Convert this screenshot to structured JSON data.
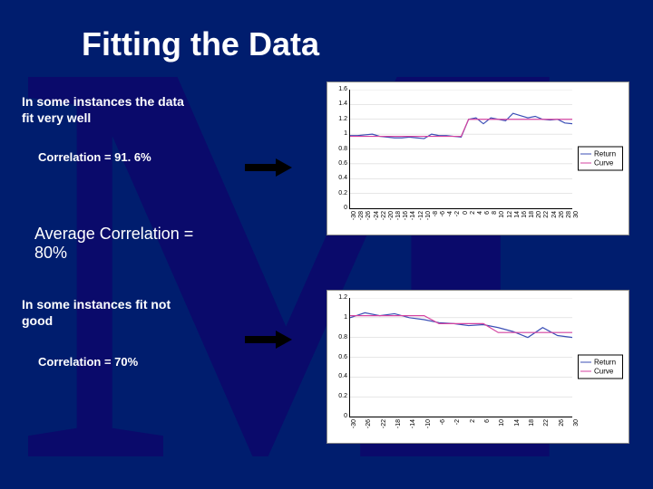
{
  "title": "Fitting the Data",
  "text": {
    "intro1": "In some instances the data\nfit very well",
    "corr1": "Correlation = 91. 6%",
    "avg": "Average Correlation =\n80%",
    "intro2": "In some instances fit not\ngood",
    "corr2": "Correlation = 70%"
  },
  "legend": {
    "return": "Return",
    "curve": "Curve",
    "return_color": "#3b4fb6",
    "curve_color": "#d443a0"
  },
  "chart_data": [
    {
      "type": "line",
      "title": "",
      "xlabel": "",
      "ylabel": "",
      "ylim": [
        0,
        1.6
      ],
      "yticks": [
        0,
        0.2,
        0.4,
        0.6,
        0.8,
        1,
        1.2,
        1.4,
        1.6
      ],
      "categories": [
        -30,
        -28,
        -26,
        -24,
        -22,
        -20,
        -18,
        -16,
        -14,
        -12,
        -10,
        -8,
        -6,
        -4,
        -2,
        0,
        2,
        4,
        6,
        8,
        10,
        12,
        14,
        16,
        18,
        20,
        22,
        24,
        26,
        28,
        30
      ],
      "series": [
        {
          "name": "Return",
          "color": "#3b4fb6",
          "values": [
            0.98,
            0.98,
            0.99,
            1.0,
            0.97,
            0.96,
            0.95,
            0.95,
            0.96,
            0.95,
            0.94,
            1.0,
            0.98,
            0.98,
            0.97,
            0.96,
            1.2,
            1.22,
            1.14,
            1.22,
            1.2,
            1.18,
            1.28,
            1.25,
            1.22,
            1.24,
            1.2,
            1.19,
            1.2,
            1.15,
            1.14
          ]
        },
        {
          "name": "Curve",
          "color": "#d443a0",
          "values": [
            0.97,
            0.97,
            0.97,
            0.97,
            0.97,
            0.97,
            0.97,
            0.97,
            0.97,
            0.97,
            0.97,
            0.97,
            0.97,
            0.97,
            0.97,
            0.97,
            1.2,
            1.2,
            1.2,
            1.2,
            1.2,
            1.2,
            1.2,
            1.2,
            1.2,
            1.2,
            1.2,
            1.2,
            1.2,
            1.2,
            1.2
          ]
        }
      ]
    },
    {
      "type": "line",
      "title": "",
      "xlabel": "",
      "ylabel": "",
      "ylim": [
        0,
        1.2
      ],
      "yticks": [
        0,
        0.2,
        0.4,
        0.6,
        0.8,
        1,
        1.2
      ],
      "categories": [
        -30,
        -26,
        -22,
        -18,
        -14,
        -10,
        -6,
        -2,
        2,
        6,
        10,
        14,
        18,
        22,
        26,
        30
      ],
      "series": [
        {
          "name": "Return",
          "color": "#3b4fb6",
          "values": [
            1.0,
            1.05,
            1.02,
            1.04,
            1.0,
            0.98,
            0.95,
            0.94,
            0.92,
            0.93,
            0.9,
            0.86,
            0.8,
            0.9,
            0.82,
            0.8
          ]
        },
        {
          "name": "Curve",
          "color": "#d443a0",
          "values": [
            1.02,
            1.02,
            1.02,
            1.02,
            1.02,
            1.02,
            0.94,
            0.94,
            0.94,
            0.94,
            0.85,
            0.85,
            0.85,
            0.85,
            0.85,
            0.85
          ]
        }
      ]
    }
  ]
}
